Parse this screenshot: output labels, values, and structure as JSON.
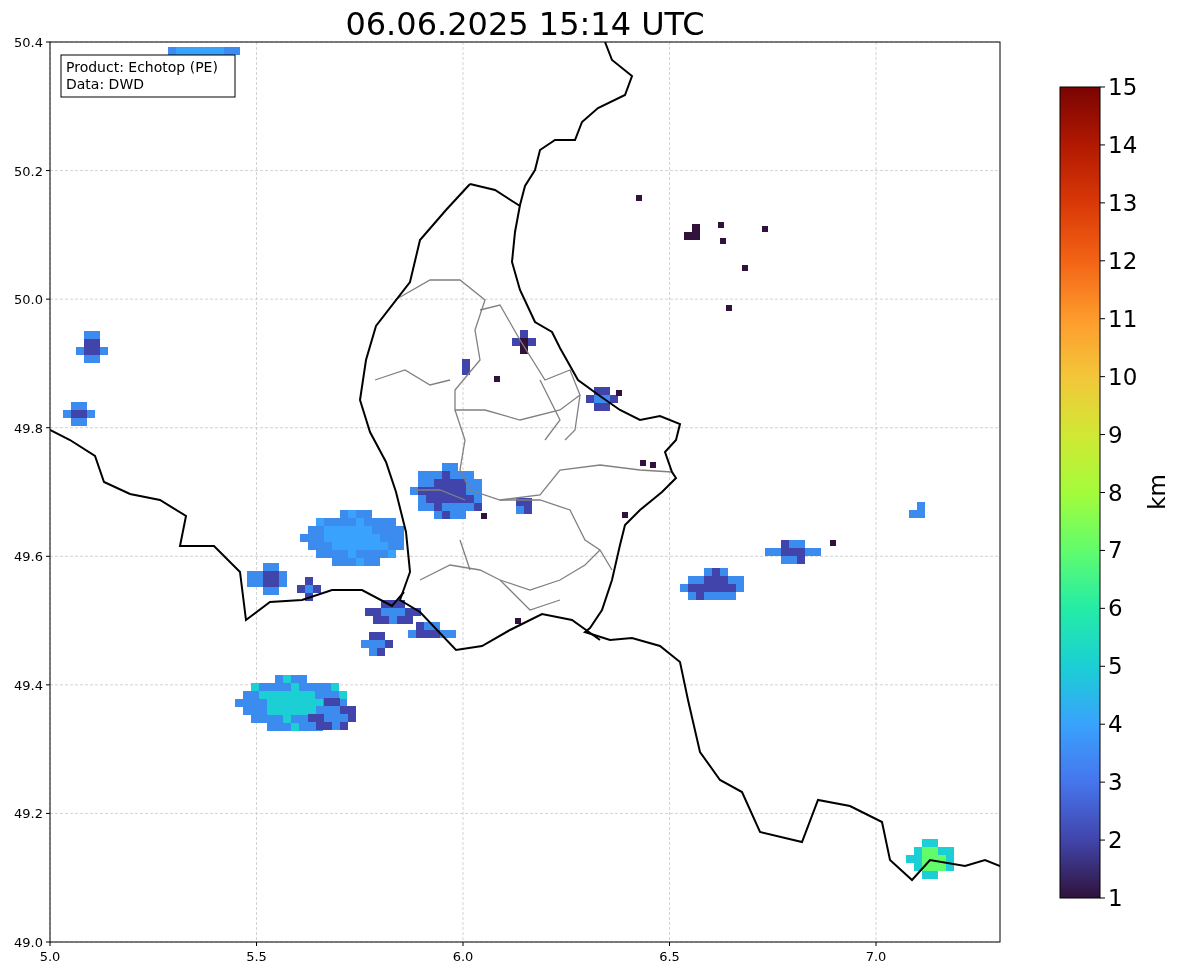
{
  "title": "06.06.2025 15:14 UTC",
  "legend": [
    "Product: Echotop (PE)",
    "Data: DWD"
  ],
  "x_ticks": [
    "5.0",
    "5.5",
    "6.0",
    "6.5",
    "7.0"
  ],
  "y_ticks": [
    "50.4",
    "50.2",
    "50.0",
    "49.8",
    "49.6",
    "49.4",
    "49.2",
    "49.0"
  ],
  "colorbar": {
    "ticks": [
      "15",
      "14",
      "13",
      "12",
      "11",
      "10",
      "9",
      "8",
      "7",
      "6",
      "5",
      "4",
      "3",
      "2",
      "1"
    ],
    "label": "km"
  }
}
